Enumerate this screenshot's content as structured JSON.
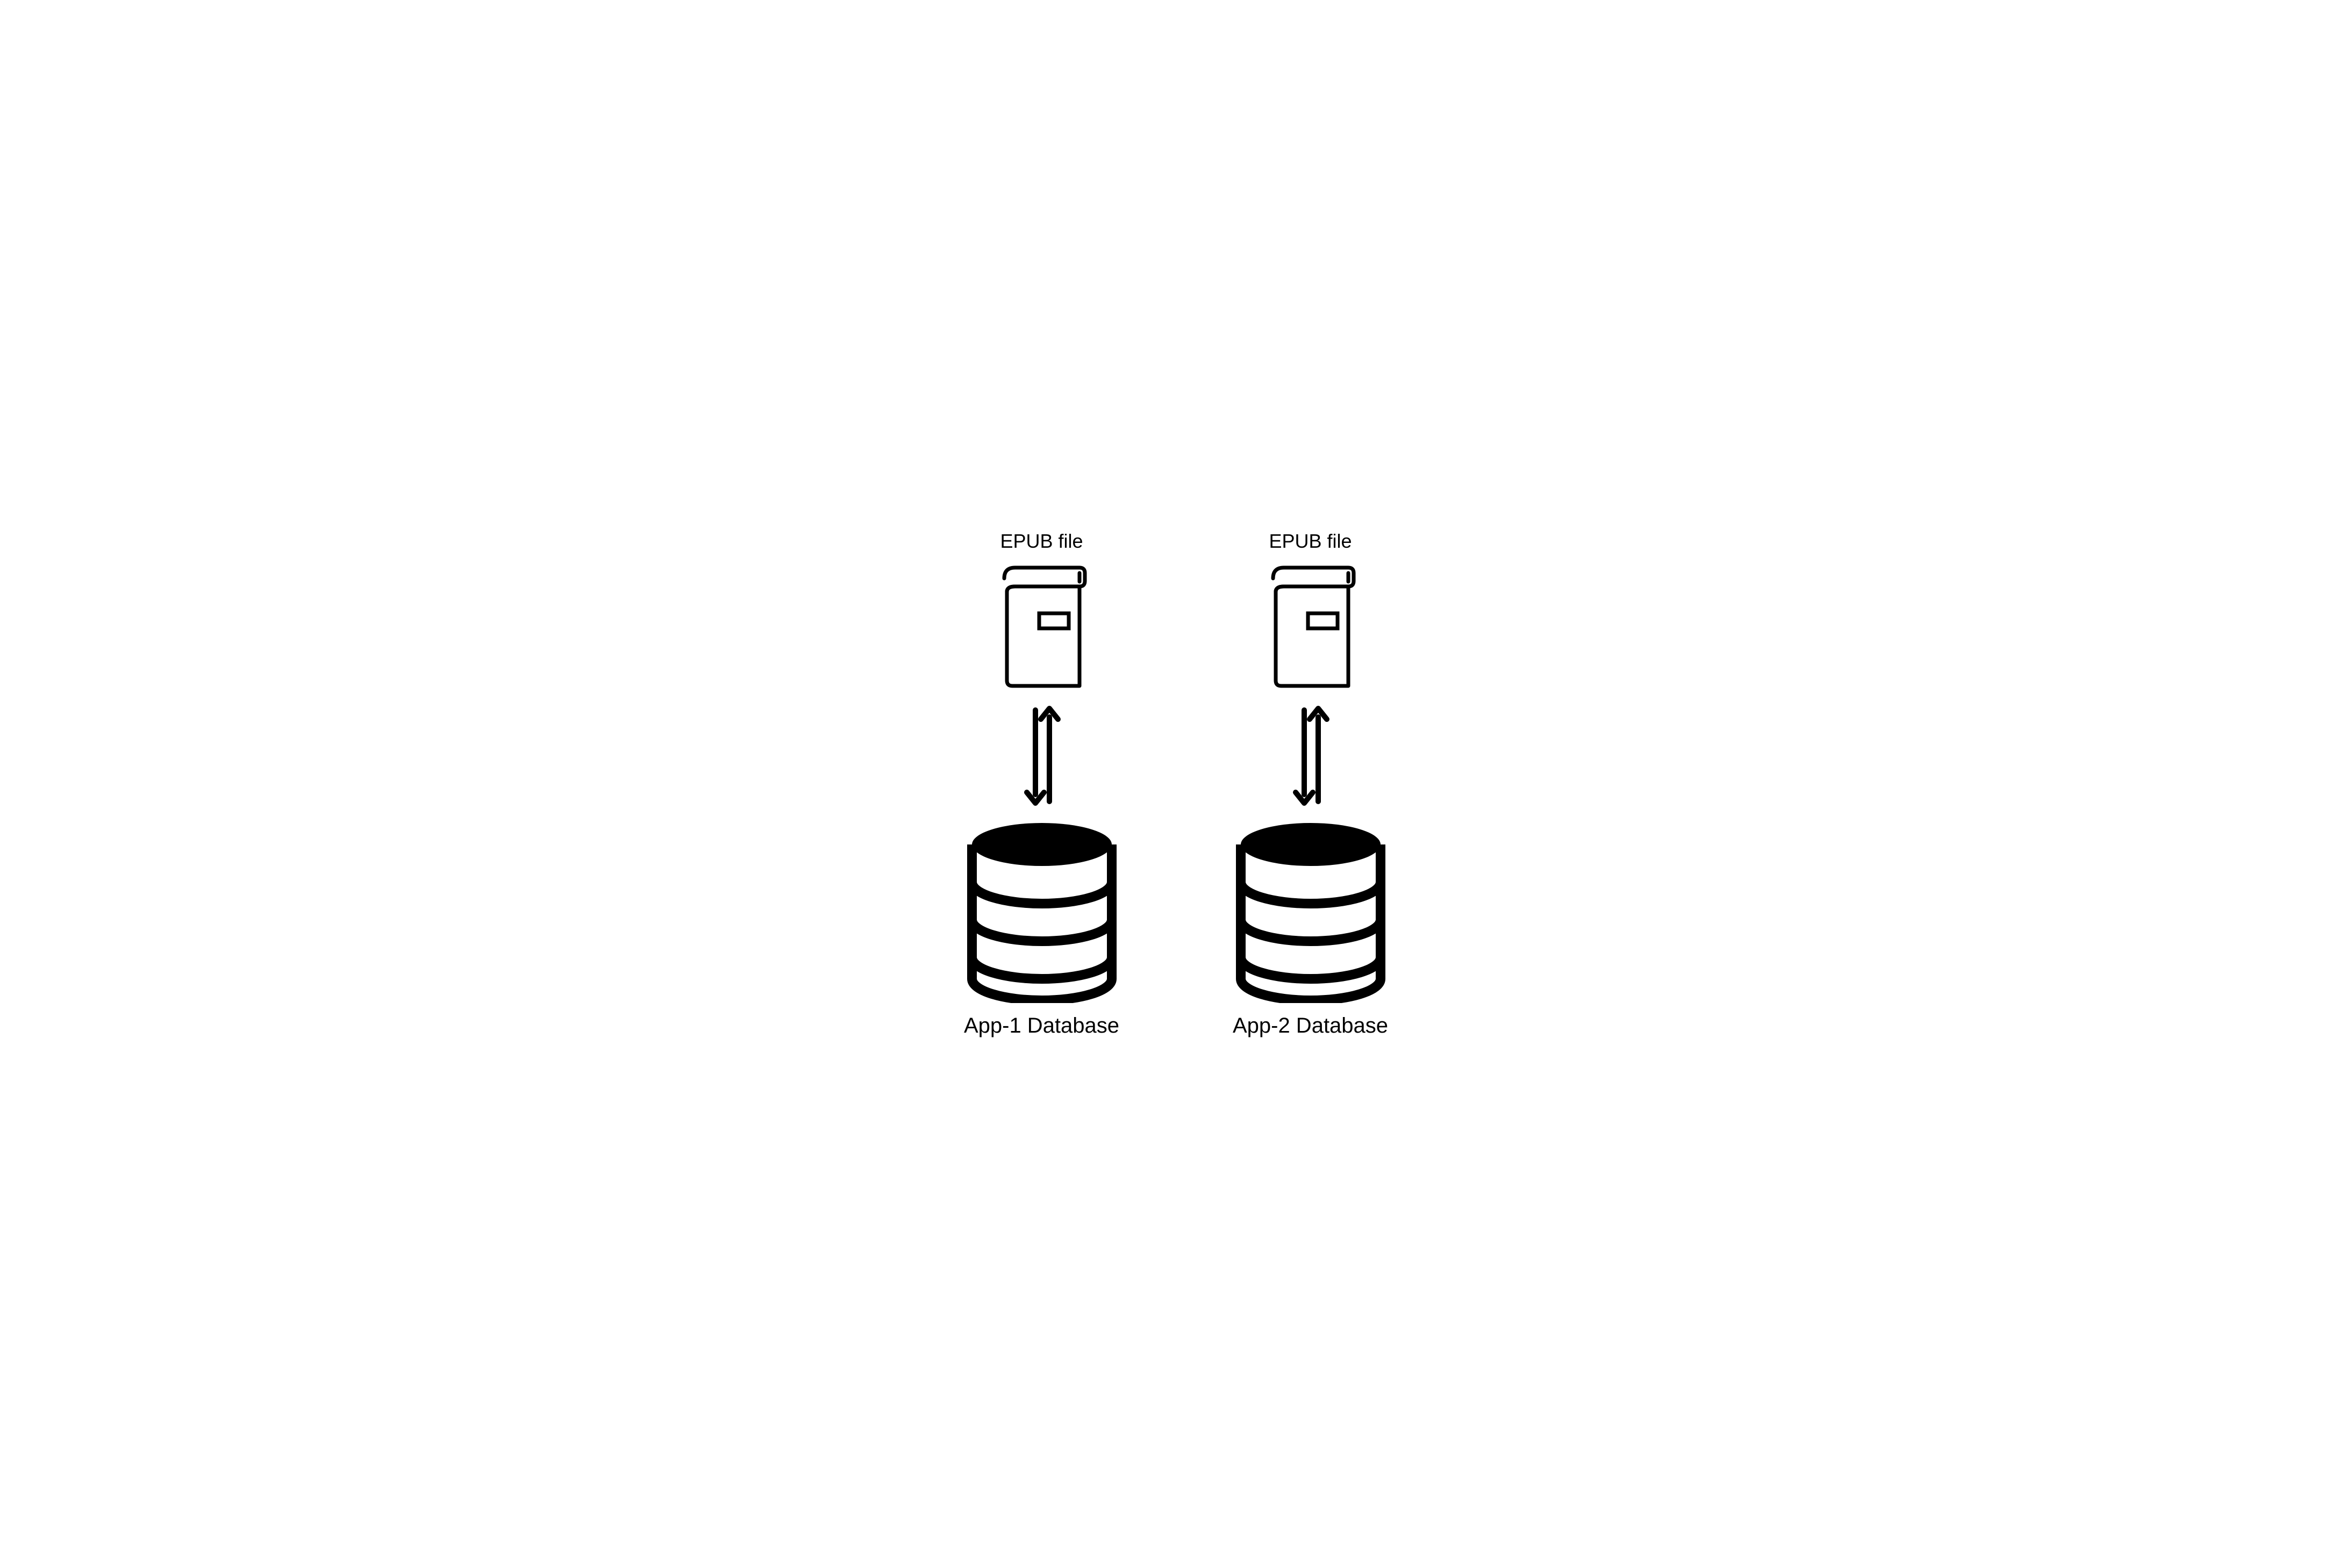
{
  "columns": [
    {
      "top_label": "EPUB file",
      "bottom_label": "App-1 Database"
    },
    {
      "top_label": "EPUB file",
      "bottom_label": "App-2 Database"
    }
  ]
}
